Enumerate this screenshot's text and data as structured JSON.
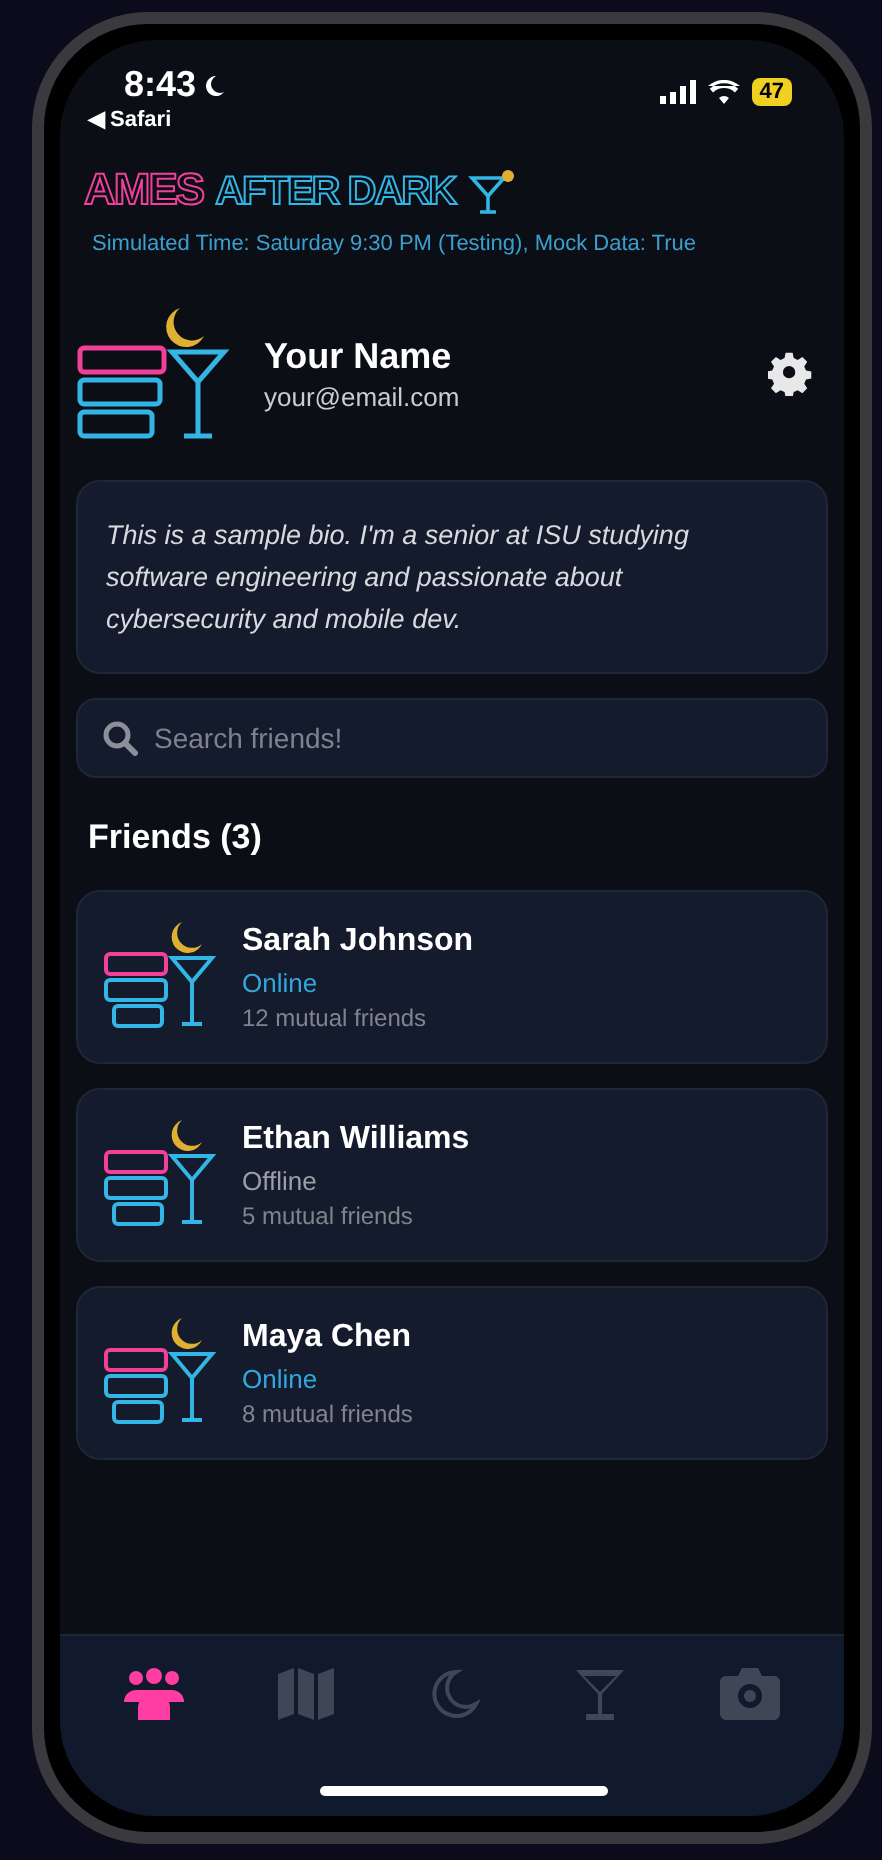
{
  "status_bar": {
    "time": "8:43",
    "back_label": "◀ Safari",
    "battery": "47"
  },
  "header": {
    "logo_first": "AMES",
    "logo_second": "AFTER DARK",
    "info": "Simulated Time: Saturday 9:30 PM (Testing), Mock Data: True"
  },
  "profile": {
    "name": "Your Name",
    "email": "your@email.com",
    "bio": "This is a sample bio. I'm a senior at ISU studying software engineering and passionate about cybersecurity and mobile dev."
  },
  "search": {
    "placeholder": "Search friends!"
  },
  "friends_heading": "Friends (3)",
  "friends": [
    {
      "name": "Sarah Johnson",
      "status": "Online",
      "online": true,
      "mutual": "12 mutual friends"
    },
    {
      "name": "Ethan Williams",
      "status": "Offline",
      "online": false,
      "mutual": "5 mutual friends"
    },
    {
      "name": "Maya Chen",
      "status": "Online",
      "online": true,
      "mutual": "8 mutual friends"
    }
  ],
  "tab_bar": [
    {
      "kind": "friends",
      "selected": true
    },
    {
      "kind": "map",
      "selected": false
    },
    {
      "kind": "moon",
      "selected": false
    },
    {
      "kind": "cocktail",
      "selected": false
    },
    {
      "kind": "camera",
      "selected": false
    }
  ]
}
